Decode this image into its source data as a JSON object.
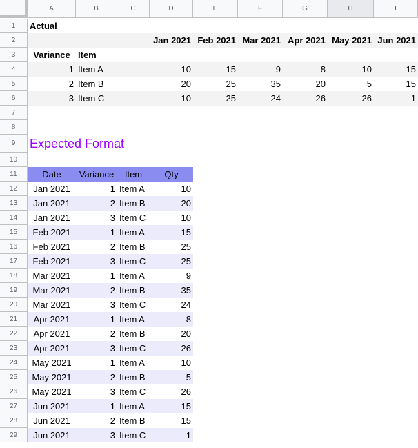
{
  "colors": {
    "header_fill": "#8a8cf0",
    "band_light": "#ebebfc",
    "band_gray": "#f3f3f3",
    "title_purple": "#9900ff"
  },
  "columns": [
    "A",
    "B",
    "C",
    "D",
    "E",
    "F",
    "G",
    "H",
    "I"
  ],
  "rows": [
    "1",
    "2",
    "3",
    "4",
    "5",
    "6",
    "7",
    "8",
    "9",
    "10",
    "11",
    "12",
    "13",
    "14",
    "15",
    "16",
    "17",
    "18",
    "19",
    "20",
    "21",
    "22",
    "23",
    "24",
    "25",
    "26",
    "27",
    "28",
    "29"
  ],
  "actual": {
    "title": "Actual",
    "months": [
      "Jan 2021",
      "Feb 2021",
      "Mar 2021",
      "Apr 2021",
      "May 2021",
      "Jun 2021"
    ],
    "header_variance": "Variance",
    "header_item": "Item",
    "data": [
      {
        "variance": "1",
        "item": "Item A",
        "values": [
          "10",
          "15",
          "9",
          "8",
          "10",
          "15"
        ]
      },
      {
        "variance": "2",
        "item": "Item B",
        "values": [
          "20",
          "25",
          "35",
          "20",
          "5",
          "15"
        ]
      },
      {
        "variance": "3",
        "item": "Item C",
        "values": [
          "10",
          "25",
          "24",
          "26",
          "26",
          "1"
        ]
      }
    ]
  },
  "expected": {
    "title": "Expected Format",
    "headers": [
      "Date",
      "Variance",
      "Item",
      "Qty"
    ],
    "rows": [
      [
        "Jan 2021",
        "1",
        "Item A",
        "10"
      ],
      [
        "Jan 2021",
        "2",
        "Item B",
        "20"
      ],
      [
        "Jan 2021",
        "3",
        "Item C",
        "10"
      ],
      [
        "Feb 2021",
        "1",
        "Item A",
        "15"
      ],
      [
        "Feb 2021",
        "2",
        "Item B",
        "25"
      ],
      [
        "Feb 2021",
        "3",
        "Item C",
        "25"
      ],
      [
        "Mar 2021",
        "1",
        "Item A",
        "9"
      ],
      [
        "Mar 2021",
        "2",
        "Item B",
        "35"
      ],
      [
        "Mar 2021",
        "3",
        "Item C",
        "24"
      ],
      [
        "Apr 2021",
        "1",
        "Item A",
        "8"
      ],
      [
        "Apr 2021",
        "2",
        "Item B",
        "20"
      ],
      [
        "Apr 2021",
        "3",
        "Item C",
        "26"
      ],
      [
        "May 2021",
        "1",
        "Item A",
        "10"
      ],
      [
        "May 2021",
        "2",
        "Item B",
        "5"
      ],
      [
        "May 2021",
        "3",
        "Item C",
        "26"
      ],
      [
        "Jun 2021",
        "1",
        "Item A",
        "15"
      ],
      [
        "Jun 2021",
        "2",
        "Item B",
        "15"
      ],
      [
        "Jun 2021",
        "3",
        "Item C",
        "1"
      ]
    ]
  }
}
